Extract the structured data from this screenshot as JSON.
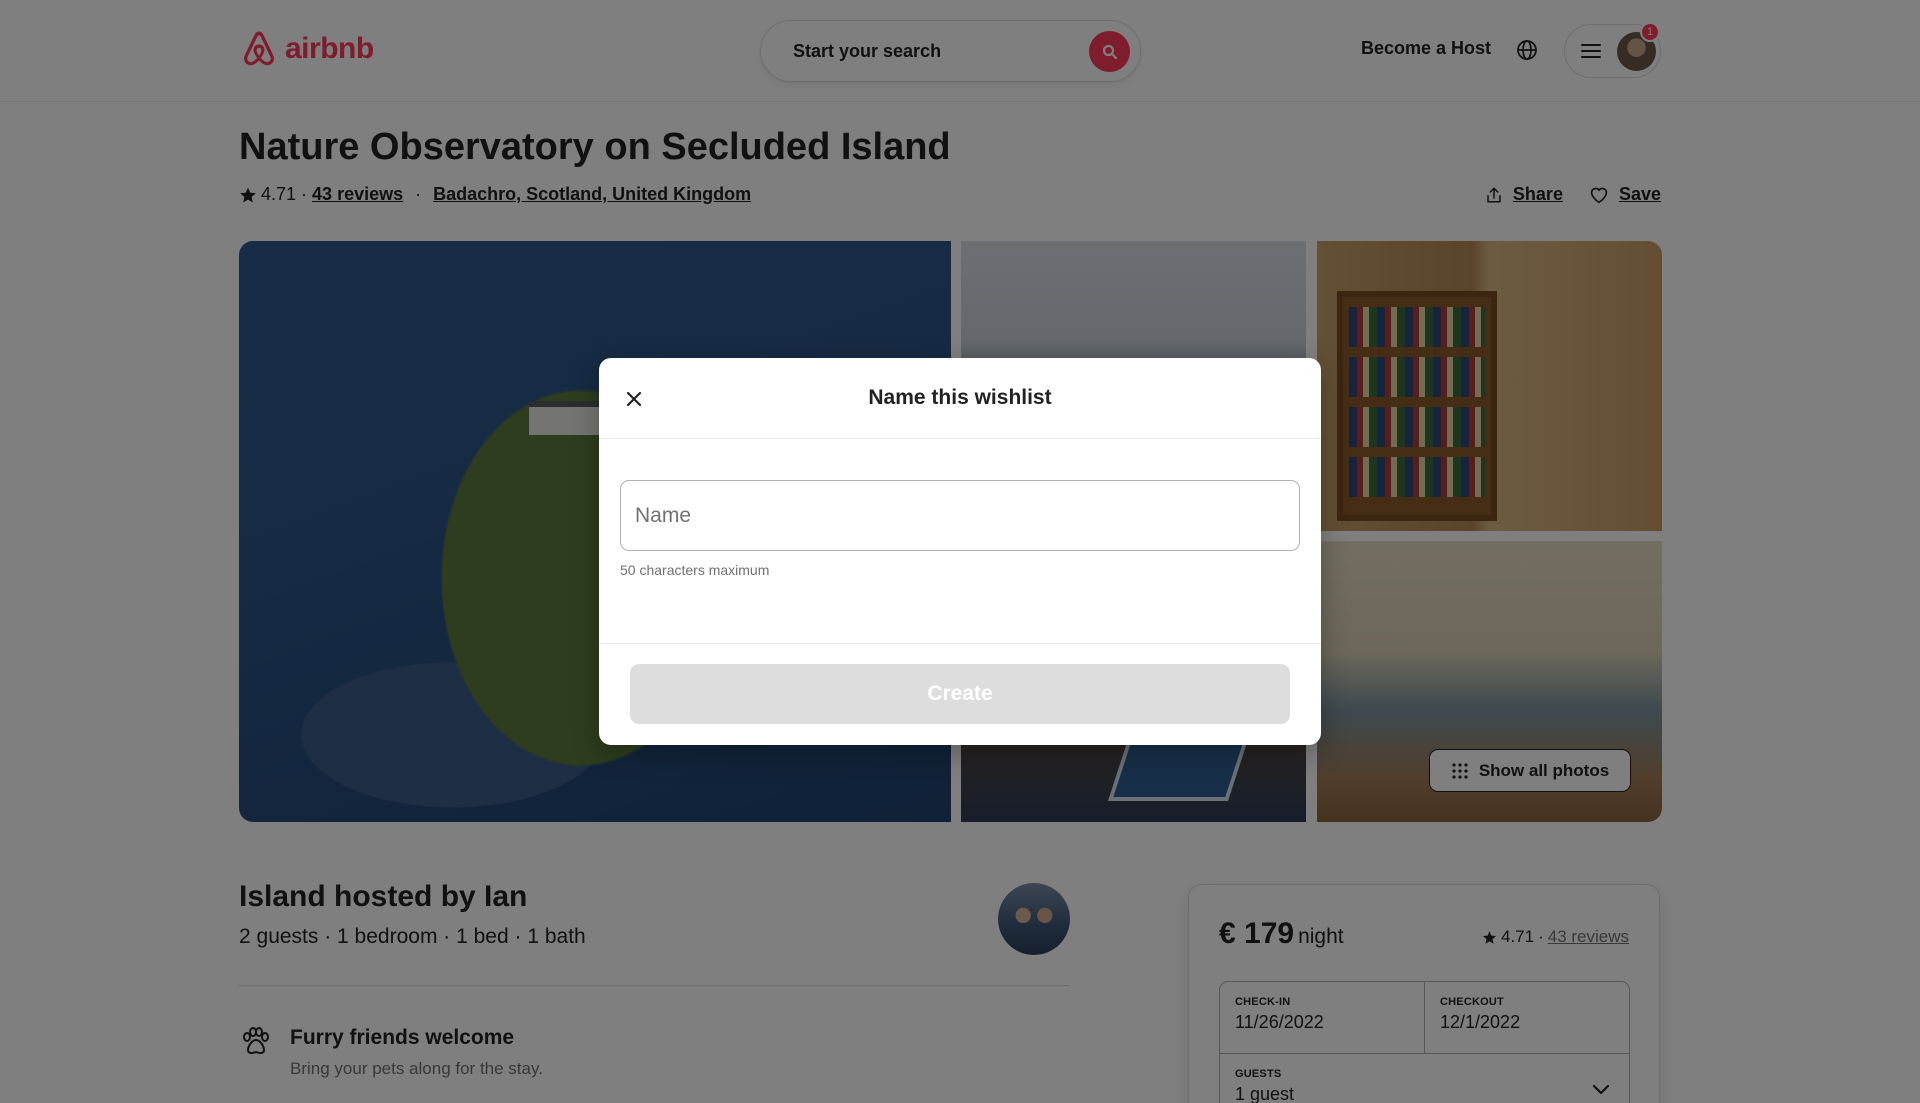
{
  "header": {
    "brand": "airbnb",
    "search_label": "Start your search",
    "become_host": "Become a Host",
    "notification_count": "1"
  },
  "listing": {
    "title": "Nature Observatory on Secluded Island",
    "rating": "4.71",
    "reviews": "43 reviews",
    "location": "Badachro, Scotland, United Kingdom",
    "share_label": "Share",
    "save_label": "Save",
    "show_all_photos": "Show all photos"
  },
  "host": {
    "title": "Island hosted by Ian",
    "details": "2 guests · 1 bedroom · 1 bed · 1 bath"
  },
  "features": [
    {
      "title": "Furry friends welcome",
      "subtitle": "Bring your pets along for the stay."
    }
  ],
  "booking": {
    "price": "€ 179",
    "per": "night",
    "rating": "4.71",
    "reviews": "43 reviews",
    "checkin_label": "CHECK-IN",
    "checkin_value": "11/26/2022",
    "checkout_label": "CHECKOUT",
    "checkout_value": "12/1/2022",
    "guests_label": "GUESTS",
    "guests_value": "1 guest"
  },
  "modal": {
    "title": "Name this wishlist",
    "name_placeholder": "Name",
    "name_value": "",
    "hint": "50 characters maximum",
    "create_label": "Create"
  },
  "colors": {
    "brand": "#FF385C",
    "text": "#222222",
    "muted": "#717171",
    "disabled": "#DDDDDD"
  }
}
